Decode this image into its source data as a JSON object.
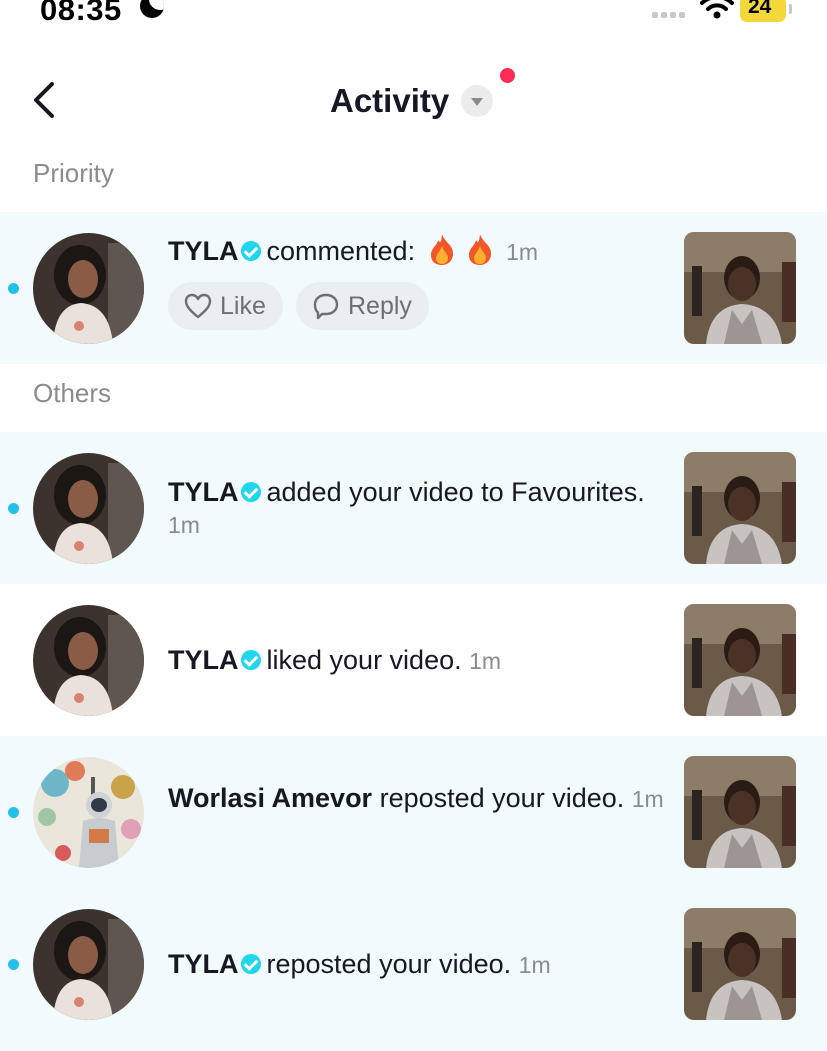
{
  "status_bar": {
    "time": "08:35",
    "battery": "24"
  },
  "header": {
    "title": "Activity"
  },
  "sections": {
    "priority": "Priority",
    "others": "Others"
  },
  "priority_item": {
    "username": "TYLA",
    "action": "commented:",
    "comment": "🔥 🔥",
    "time": "1m",
    "like_label": "Like",
    "reply_label": "Reply"
  },
  "others": [
    {
      "username": "TYLA",
      "action": "added your video to Favourites.",
      "time": "1m"
    },
    {
      "username": "TYLA",
      "action": "liked your video.",
      "time": "1m"
    },
    {
      "username": "Worlasi Amevor",
      "action": "reposted your video.",
      "time": "1m"
    },
    {
      "username": "TYLA",
      "action": "reposted your video.",
      "time": "1m"
    }
  ],
  "colors": {
    "unread_bg": "#f1fbfd",
    "unread_dot": "#25c0ea",
    "verified": "#20d5ec",
    "notification_dot": "#fe2c55"
  }
}
